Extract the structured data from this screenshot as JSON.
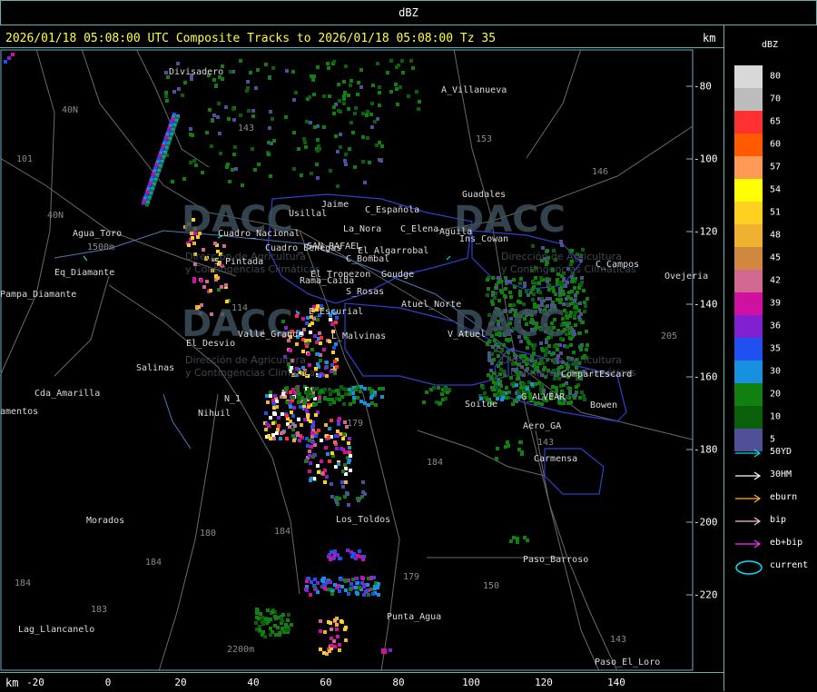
{
  "window": {
    "title": "dBZ"
  },
  "header": {
    "text": "2026/01/18 05:08:00 UTC Composite Tracks to 2026/01/18 05:08:00 Tz 35",
    "units": "km"
  },
  "axes": {
    "x_units": "km",
    "x_ticks": [
      "-20",
      "0",
      "20",
      "40",
      "60",
      "80",
      "100",
      "120",
      "140"
    ],
    "y_ticks": [
      "-80",
      "-100",
      "-120",
      "-140",
      "-160",
      "-180",
      "-200",
      "-220"
    ]
  },
  "legend": {
    "title": "dBZ",
    "levels": [
      {
        "label": "80",
        "color": "#d8d8d8"
      },
      {
        "label": "70",
        "color": "#bcbcbc"
      },
      {
        "label": "65",
        "color": "#ff3030"
      },
      {
        "label": "60",
        "color": "#ff5a00"
      },
      {
        "label": "57",
        "color": "#ff9955"
      },
      {
        "label": "54",
        "color": "#ffff00"
      },
      {
        "label": "51",
        "color": "#ffd020"
      },
      {
        "label": "48",
        "color": "#f0b030"
      },
      {
        "label": "45",
        "color": "#d08840"
      },
      {
        "label": "42",
        "color": "#d06890"
      },
      {
        "label": "39",
        "color": "#d010a0"
      },
      {
        "label": "36",
        "color": "#8020d0"
      },
      {
        "label": "35",
        "color": "#2050f0"
      },
      {
        "label": "30",
        "color": "#1890e0"
      },
      {
        "label": "20",
        "color": "#108010"
      },
      {
        "label": "10",
        "color": "#0a600a"
      },
      {
        "label": "5",
        "color": "#505098"
      }
    ],
    "tracks": [
      {
        "label": "50YD",
        "color": "#00e0e0"
      },
      {
        "label": "30HM",
        "color": "#ffffff"
      },
      {
        "label": "eburn",
        "color": "#ffb030"
      },
      {
        "label": "bip",
        "color": "#ffc0d0"
      },
      {
        "label": "eb+bip",
        "color": "#ff30ff"
      },
      {
        "label": "current",
        "color": "#00e0ff"
      }
    ]
  },
  "watermark": {
    "brand": "DACC",
    "line1": "Dirección de Agricultura",
    "line2": "y Contingencias Climáticas"
  },
  "places": [
    {
      "name": "Divisadero",
      "x": 186,
      "y": 20
    },
    {
      "name": "A_Villanueva",
      "x": 486,
      "y": 40
    },
    {
      "name": "40N",
      "x": 68,
      "y": 62
    },
    {
      "name": "143",
      "x": 262,
      "y": 82
    },
    {
      "name": "153",
      "x": 524,
      "y": 94
    },
    {
      "name": "101",
      "x": 18,
      "y": 116
    },
    {
      "name": "146",
      "x": 652,
      "y": 130
    },
    {
      "name": "Guadales",
      "x": 509,
      "y": 155
    },
    {
      "name": "Jaime",
      "x": 354,
      "y": 166
    },
    {
      "name": "C_Española",
      "x": 402,
      "y": 172
    },
    {
      "name": "Usillal",
      "x": 318,
      "y": 176
    },
    {
      "name": "40N",
      "x": 52,
      "y": 178
    },
    {
      "name": "La_Nora",
      "x": 378,
      "y": 193
    },
    {
      "name": "C_Elena",
      "x": 441,
      "y": 193
    },
    {
      "name": "Aguila",
      "x": 484,
      "y": 196
    },
    {
      "name": "Agua_Toro",
      "x": 80,
      "y": 198
    },
    {
      "name": "Cuadro_Nacional",
      "x": 240,
      "y": 198
    },
    {
      "name": "Ins_Cowan",
      "x": 506,
      "y": 204
    },
    {
      "name": "Cuadro_Benegas",
      "x": 292,
      "y": 214
    },
    {
      "name": "SAN_RAFAEL",
      "x": 338,
      "y": 212
    },
    {
      "name": "El_Algarrobal",
      "x": 394,
      "y": 217
    },
    {
      "name": "C_Bombal",
      "x": 381,
      "y": 226
    },
    {
      "name": "S_Pintada",
      "x": 236,
      "y": 229
    },
    {
      "name": "C_Campos",
      "x": 656,
      "y": 232
    },
    {
      "name": "Ovejeria",
      "x": 732,
      "y": 245
    },
    {
      "name": "1500m",
      "x": 96,
      "y": 213
    },
    {
      "name": "Eq_Diamante",
      "x": 60,
      "y": 241
    },
    {
      "name": "Rama_Caida",
      "x": 330,
      "y": 250
    },
    {
      "name": "El_Tropezon",
      "x": 342,
      "y": 243
    },
    {
      "name": "Goudge",
      "x": 420,
      "y": 243
    },
    {
      "name": "Pampa_Diamante",
      "x": 0,
      "y": 265
    },
    {
      "name": "S_Rosas",
      "x": 381,
      "y": 262
    },
    {
      "name": "Atuel_Norte",
      "x": 442,
      "y": 276
    },
    {
      "name": "114",
      "x": 255,
      "y": 280
    },
    {
      "name": "E_Escurial",
      "x": 340,
      "y": 284
    },
    {
      "name": "Valle_Grande",
      "x": 262,
      "y": 309
    },
    {
      "name": "L_Malvinas",
      "x": 365,
      "y": 311
    },
    {
      "name": "V_Atuel",
      "x": 493,
      "y": 309
    },
    {
      "name": "El_Desvio",
      "x": 205,
      "y": 319
    },
    {
      "name": "205",
      "x": 728,
      "y": 311
    },
    {
      "name": "CompartEscard",
      "x": 618,
      "y": 353
    },
    {
      "name": "Salinas",
      "x": 150,
      "y": 346
    },
    {
      "name": "Cda_Amarilla",
      "x": 38,
      "y": 374
    },
    {
      "name": "N_1",
      "x": 247,
      "y": 380
    },
    {
      "name": "G_ALVEAR",
      "x": 574,
      "y": 378
    },
    {
      "name": "Soitue",
      "x": 512,
      "y": 386
    },
    {
      "name": "Bowen",
      "x": 650,
      "y": 387
    },
    {
      "name": "amentos",
      "x": 0,
      "y": 394
    },
    {
      "name": "Nihuil",
      "x": 218,
      "y": 396
    },
    {
      "name": "179",
      "x": 382,
      "y": 407
    },
    {
      "name": "Aero_GA",
      "x": 576,
      "y": 410
    },
    {
      "name": "143",
      "x": 592,
      "y": 428
    },
    {
      "name": "184",
      "x": 470,
      "y": 450
    },
    {
      "name": "Carmensa",
      "x": 588,
      "y": 446
    },
    {
      "name": "Los_Toldos",
      "x": 370,
      "y": 513
    },
    {
      "name": "Morados",
      "x": 95,
      "y": 514
    },
    {
      "name": "180",
      "x": 220,
      "y": 528
    },
    {
      "name": "184",
      "x": 302,
      "y": 526
    },
    {
      "name": "184",
      "x": 160,
      "y": 560
    },
    {
      "name": "Paso_Barroso",
      "x": 576,
      "y": 557
    },
    {
      "name": "179",
      "x": 444,
      "y": 576
    },
    {
      "name": "150",
      "x": 532,
      "y": 586
    },
    {
      "name": "184",
      "x": 16,
      "y": 583
    },
    {
      "name": "183",
      "x": 100,
      "y": 612
    },
    {
      "name": "Punta_Agua",
      "x": 426,
      "y": 620
    },
    {
      "name": "Lag_Llancanelo",
      "x": 20,
      "y": 634
    },
    {
      "name": "143",
      "x": 672,
      "y": 645
    },
    {
      "name": "2200m",
      "x": 250,
      "y": 656
    },
    {
      "name": "Paso_El_Loro",
      "x": 655,
      "y": 670
    }
  ]
}
